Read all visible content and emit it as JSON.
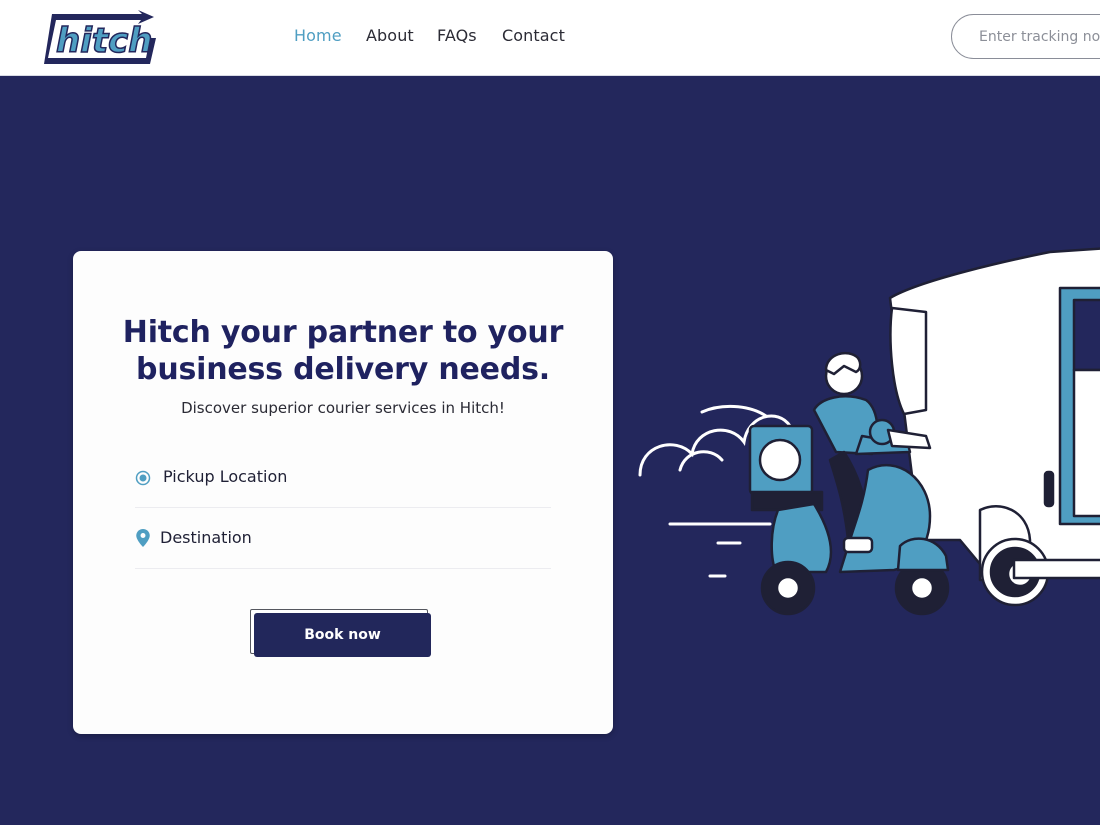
{
  "brand": {
    "logo_text": "hitch"
  },
  "nav": {
    "items": [
      {
        "label": "Home",
        "active": true
      },
      {
        "label": "About",
        "active": false
      },
      {
        "label": "FAQs",
        "active": false
      },
      {
        "label": "Contact",
        "active": false
      }
    ]
  },
  "tracking": {
    "placeholder": "Enter tracking no.",
    "value": ""
  },
  "hero": {
    "headline_line1": "Hitch your partner to your",
    "headline_line2": "business delivery needs.",
    "subheadline": "Discover superior courier services in Hitch!",
    "pickup_label": "Pickup Location",
    "destination_label": "Destination",
    "book_label": "Book now"
  },
  "colors": {
    "navy": "#23275c",
    "accent_blue": "#4f9ec2",
    "white": "#ffffff"
  },
  "icons": {
    "pickup": "radio-target-icon",
    "destination": "map-pin-icon"
  }
}
